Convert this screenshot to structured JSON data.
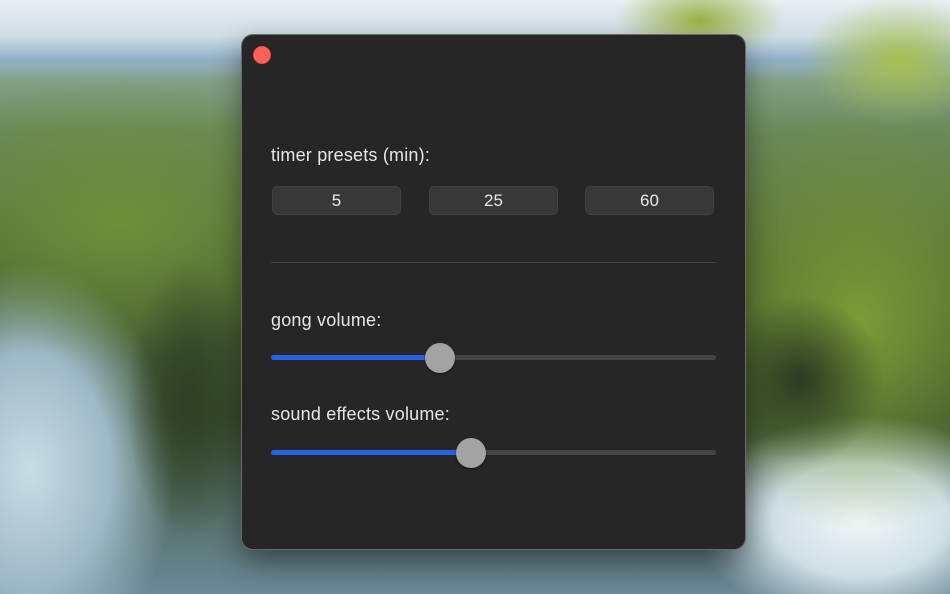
{
  "window": {
    "close_color": "#fe5f57"
  },
  "timer_presets": {
    "label": "timer presets (min):",
    "buttons": [
      "5",
      "25",
      "60"
    ]
  },
  "gong_volume": {
    "label": "gong volume:",
    "value": 0.38
  },
  "sound_effects_volume": {
    "label": "sound effects volume:",
    "value": 0.45
  },
  "colors": {
    "accent": "#2a5fe4",
    "window_bg": "#262626",
    "button_bg": "#383838",
    "knob": "#a3a3a3"
  }
}
